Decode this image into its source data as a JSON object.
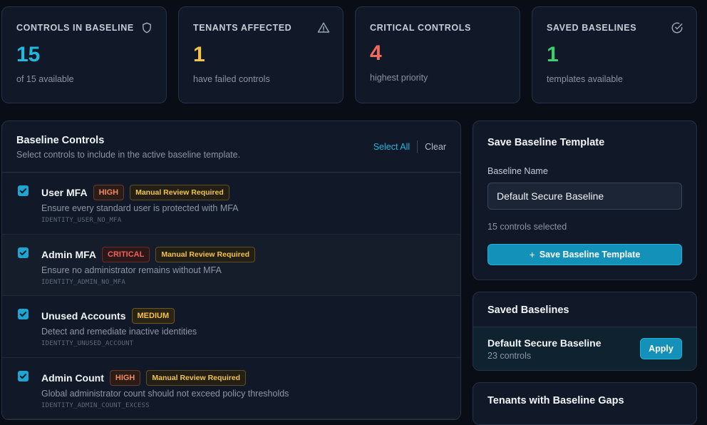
{
  "stats": [
    {
      "label": "CONTROLS IN BASELINE",
      "value": "15",
      "sub": "of 15 available",
      "color": "#22b8e0",
      "icon": "shield-icon"
    },
    {
      "label": "TENANTS AFFECTED",
      "value": "1",
      "sub": "have failed controls",
      "color": "#f5c24a",
      "icon": "warning-icon"
    },
    {
      "label": "CRITICAL CONTROLS",
      "value": "4",
      "sub": "highest priority",
      "color": "#f06b5d",
      "icon": ""
    },
    {
      "label": "SAVED BASELINES",
      "value": "1",
      "sub": "templates available",
      "color": "#3fcf6e",
      "icon": "check-circle-icon"
    }
  ],
  "controls_panel": {
    "title": "Baseline Controls",
    "description": "Select controls to include in the active baseline template.",
    "select_all": "Select All",
    "clear": "Clear",
    "items": [
      {
        "name": "User MFA",
        "severity": "HIGH",
        "severity_class": "b-high",
        "review": "Manual Review Required",
        "desc": "Ensure every standard user is protected with MFA",
        "id": "IDENTITY_USER_NO_MFA",
        "checked": true
      },
      {
        "name": "Admin MFA",
        "severity": "CRITICAL",
        "severity_class": "b-critical",
        "review": "Manual Review Required",
        "desc": "Ensure no administrator remains without MFA",
        "id": "IDENTITY_ADMIN_NO_MFA",
        "checked": true
      },
      {
        "name": "Unused Accounts",
        "severity": "MEDIUM",
        "severity_class": "b-medium",
        "review": "",
        "desc": "Detect and remediate inactive identities",
        "id": "IDENTITY_UNUSED_ACCOUNT",
        "checked": true
      },
      {
        "name": "Admin Count",
        "severity": "HIGH",
        "severity_class": "b-high",
        "review": "Manual Review Required",
        "desc": "Global administrator count should not exceed policy thresholds",
        "id": "IDENTITY_ADMIN_COUNT_EXCESS",
        "checked": true
      }
    ]
  },
  "save_panel": {
    "title": "Save Baseline Template",
    "field_label": "Baseline Name",
    "field_value": "Default Secure Baseline",
    "selected_count": "15 controls selected",
    "button_label": "Save Baseline Template"
  },
  "saved_panel": {
    "title": "Saved Baselines",
    "items": [
      {
        "name": "Default Secure Baseline",
        "count": "23 controls",
        "apply_label": "Apply"
      }
    ]
  },
  "gaps_panel": {
    "title": "Tenants with Baseline Gaps"
  }
}
